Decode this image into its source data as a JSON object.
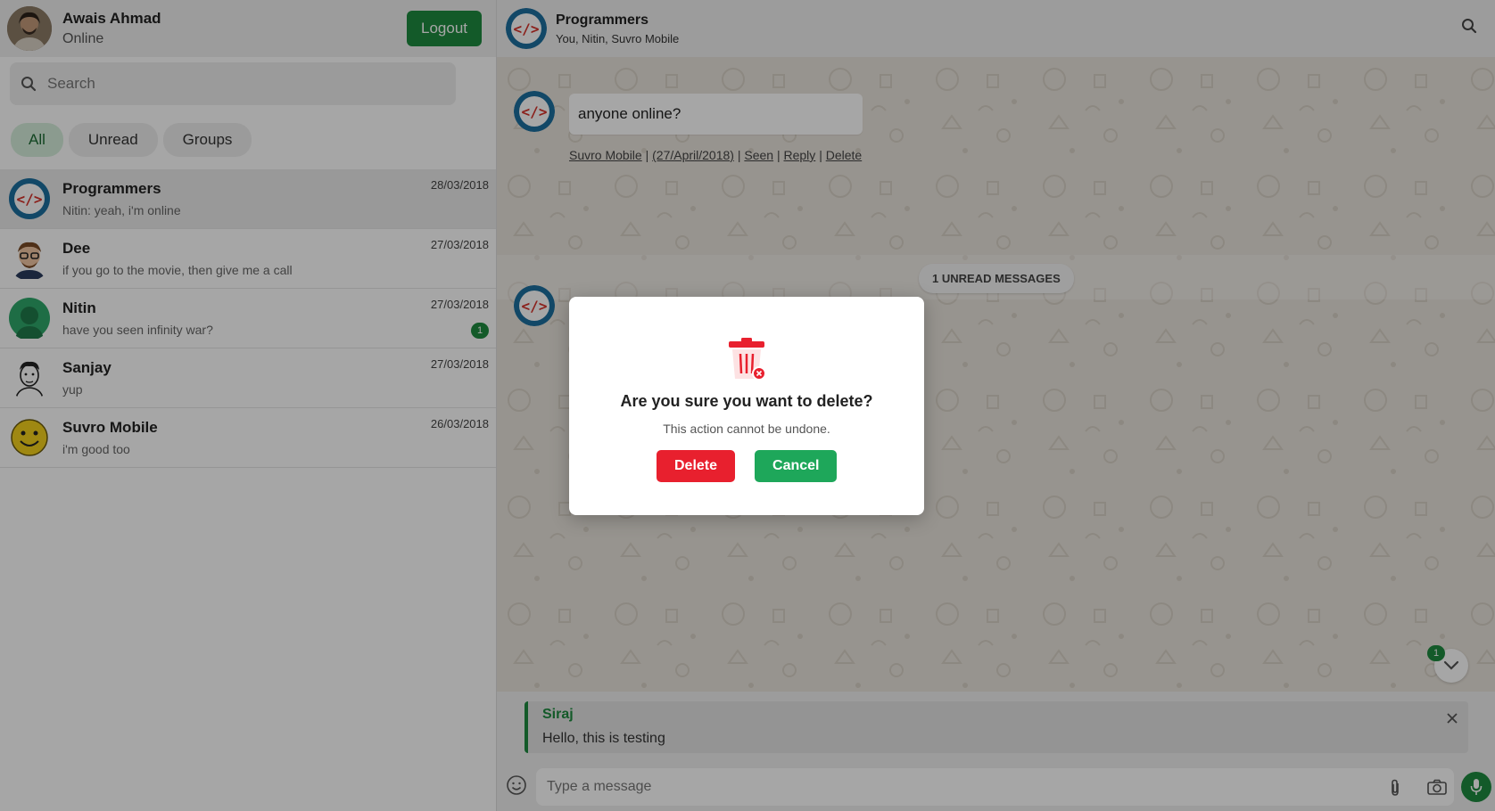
{
  "colors": {
    "accent": "#1e8a3f",
    "danger": "#e8202e",
    "chat_bg": "#e9e4dc"
  },
  "profile": {
    "name": "Awais Ahmad",
    "status": "Online",
    "logout_label": "Logout"
  },
  "search": {
    "placeholder": "Search",
    "icon": "search-icon"
  },
  "filters": [
    {
      "label": "All",
      "active": true
    },
    {
      "label": "Unread"
    },
    {
      "label": "Groups"
    }
  ],
  "chats": [
    {
      "name": "Programmers",
      "last": "Nitin: yeah, i'm online",
      "date": "28/03/2018",
      "selected": true
    },
    {
      "name": "Dee",
      "last": "if you go to the movie, then give me a call",
      "date": "27/03/2018"
    },
    {
      "name": "Nitin",
      "last": "have you seen infinity war?",
      "date": "27/03/2018",
      "unread": "1"
    },
    {
      "name": "Sanjay",
      "last": "yup",
      "date": "27/03/2018"
    },
    {
      "name": "Suvro Mobile",
      "last": "i'm good too",
      "date": "26/03/2018"
    }
  ],
  "conversation": {
    "title": "Programmers",
    "members": "You, Nitin, Suvro Mobile",
    "message": {
      "text": "anyone online?",
      "sender": "Suvro Mobile",
      "date": "(27/April/2018)",
      "seen": "Seen",
      "reply": "Reply",
      "delete": "Delete",
      "sep": "|"
    },
    "unread_label": "1 UNREAD MESSAGES",
    "scroll_badge": "1"
  },
  "reply_preview": {
    "sender": "Siraj",
    "text": "Hello, this is testing"
  },
  "composer": {
    "placeholder": "Type a message"
  },
  "dialog": {
    "question": "Are you sure you want to delete?",
    "subtext": "This action cannot be undone.",
    "delete_label": "Delete",
    "cancel_label": "Cancel"
  }
}
